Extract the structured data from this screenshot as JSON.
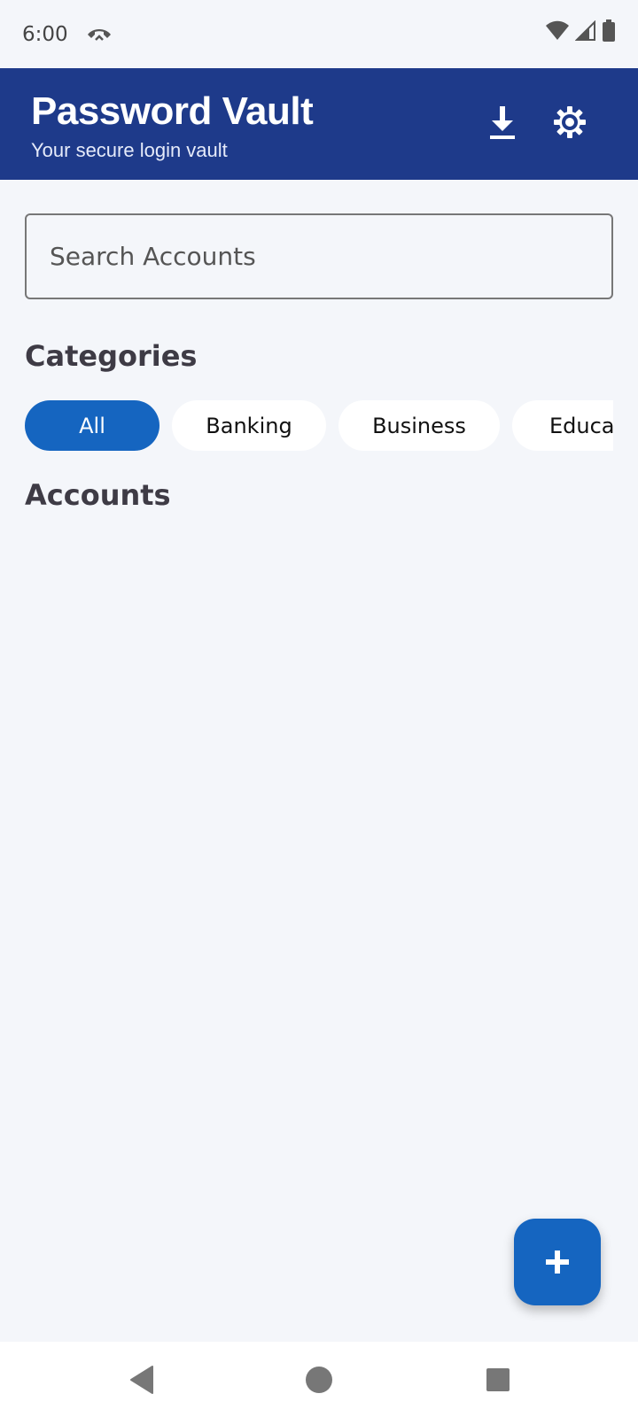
{
  "status_bar": {
    "time": "6:00"
  },
  "header": {
    "title": "Password Vault",
    "subtitle": "Your secure login vault"
  },
  "search": {
    "placeholder": "Search Accounts",
    "value": ""
  },
  "categories": {
    "title": "Categories",
    "chips": [
      {
        "label": "All",
        "active": true
      },
      {
        "label": "Banking",
        "active": false
      },
      {
        "label": "Business",
        "active": false
      },
      {
        "label": "Education",
        "active": false
      }
    ]
  },
  "accounts": {
    "title": "Accounts"
  },
  "colors": {
    "header_bg": "#1E3A8A",
    "accent": "#1565C0",
    "page_bg": "#F4F6FA"
  },
  "icons": {
    "call": "call-end-icon",
    "wifi": "wifi-icon",
    "signal": "signal-icon",
    "battery": "battery-icon",
    "download": "download-icon",
    "settings": "gear-icon",
    "add": "plus-icon",
    "back": "back-icon",
    "home": "home-icon",
    "recent": "recent-apps-icon"
  }
}
